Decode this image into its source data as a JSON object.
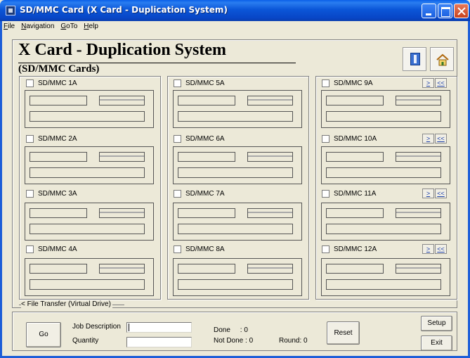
{
  "window": {
    "title": "SD/MMC Card (X Card - Duplication System)"
  },
  "menu": [
    {
      "underline": "F",
      "rest": "ile"
    },
    {
      "underline": "N",
      "rest": "avigation"
    },
    {
      "underline": "G",
      "rest": "oTo"
    },
    {
      "underline": "H",
      "rest": "elp"
    }
  ],
  "header": {
    "title": "X Card - Duplication System",
    "subtitle": "(SD/MMC Cards)",
    "icons": [
      "book-icon",
      "home-icon"
    ]
  },
  "slots": [
    {
      "label": "SD/MMC 1A"
    },
    {
      "label": "SD/MMC 2A"
    },
    {
      "label": "SD/MMC 3A"
    },
    {
      "label": "SD/MMC 4A"
    },
    {
      "label": "SD/MMC 5A"
    },
    {
      "label": "SD/MMC 6A"
    },
    {
      "label": "SD/MMC 7A"
    },
    {
      "label": "SD/MMC 8A"
    },
    {
      "label": "SD/MMC 9A"
    },
    {
      "label": "SD/MMC 10A"
    },
    {
      "label": "SD/MMC 11A"
    },
    {
      "label": "SD/MMC 12A"
    }
  ],
  "nav_buttons": {
    "next": ">",
    "back": "<<"
  },
  "file_transfer_label": "< File Transfer (Virtual Drive)",
  "bottom": {
    "go_label": "Go",
    "job_description_label": "Job Description",
    "quantity_label": "Quantity",
    "job_description_value": "",
    "quantity_value": "",
    "done_text": "Done     : 0",
    "not_done_text": "Not Done : 0",
    "round_text": "Round: 0",
    "reset_label": "Reset",
    "setup_label": "Setup",
    "exit_label": "Exit"
  }
}
